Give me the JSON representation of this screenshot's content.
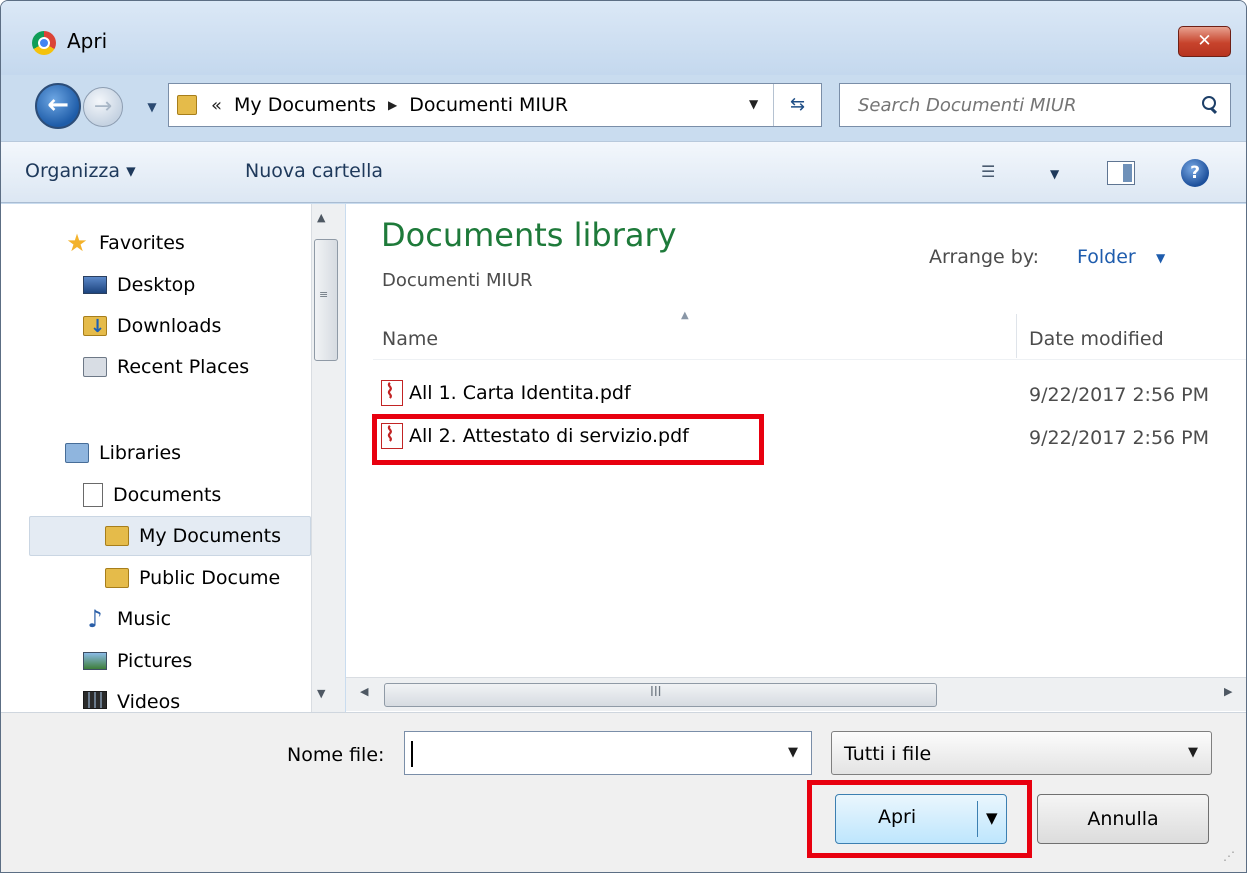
{
  "window": {
    "title": "Apri",
    "close_label": "✕"
  },
  "nav": {
    "back_glyph": "←",
    "forward_glyph": "→",
    "address": {
      "chevron": "«",
      "crumbs": [
        "My Documents",
        "Documenti MIUR"
      ],
      "separator": "▶"
    },
    "search_placeholder": "Search Documenti MIUR"
  },
  "toolbar": {
    "organize": "Organizza ▾",
    "new_folder": "Nuova cartella",
    "view_glyph": "☰",
    "help_glyph": "?"
  },
  "sidebar": {
    "favorites": "Favorites",
    "desktop": "Desktop",
    "downloads": "Downloads",
    "recent": "Recent Places",
    "libraries": "Libraries",
    "documents": "Documents",
    "my_documents": "My Documents",
    "public_documents": "Public Docume",
    "music": "Music",
    "pictures": "Pictures",
    "videos": "Videos"
  },
  "library": {
    "title": "Documents library",
    "subtitle": "Documenti MIUR",
    "arrange_label": "Arrange by:",
    "arrange_value": "Folder"
  },
  "columns": {
    "name": "Name",
    "date": "Date modified"
  },
  "files": [
    {
      "name": "All 1. Carta Identita.pdf",
      "date": "9/22/2017 2:56 PM"
    },
    {
      "name": "All 2. Attestato di servizio.pdf",
      "date": "9/22/2017 2:56 PM"
    }
  ],
  "scroll": {
    "grip": "≡",
    "hgrip": "III"
  },
  "footer": {
    "filename_label": "Nome file:",
    "filename_value": "",
    "filetype_value": "Tutti i file",
    "open_label": "Apri",
    "cancel_label": "Annulla"
  },
  "colors": {
    "highlight": "#e8000f",
    "library_title": "#1e7a3a",
    "link": "#1e5cad"
  }
}
